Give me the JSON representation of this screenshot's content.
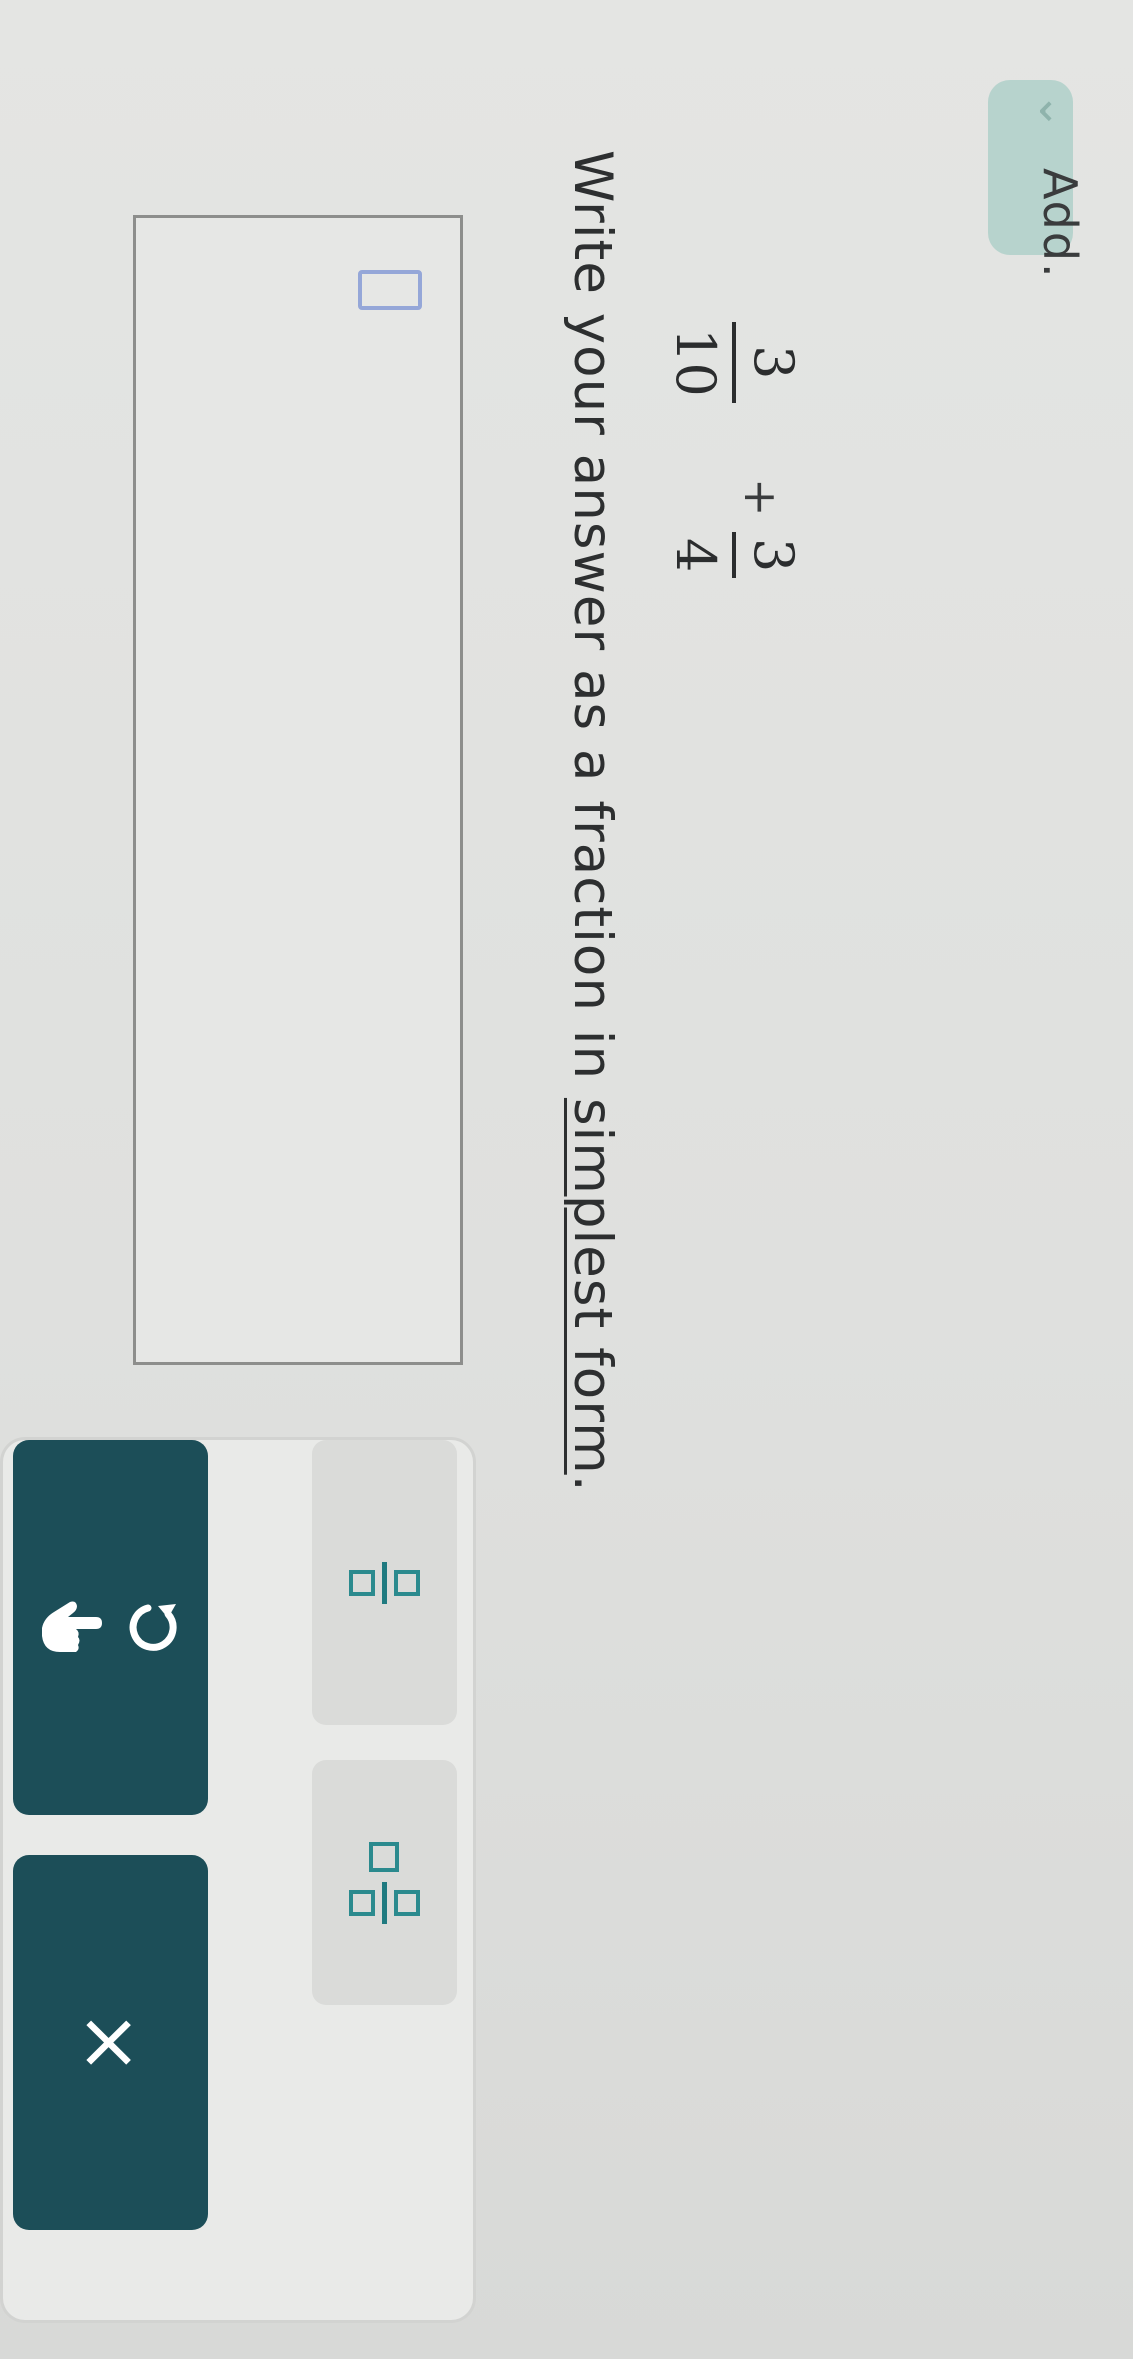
{
  "problem": {
    "prompt": "Add.",
    "expression": {
      "first": {
        "numerator": "3",
        "denominator": "10"
      },
      "operator": "+",
      "second": {
        "numerator": "3",
        "denominator": "4"
      }
    },
    "instruction_before": "Write your answer as a fraction in ",
    "instruction_link": "simplest form",
    "instruction_after": "."
  },
  "answer": {
    "value": "",
    "placeholder": ""
  },
  "tools": {
    "fraction_tool_icon": "fraction-template-icon",
    "mixed_number_tool_icon": "mixed-number-template-icon",
    "undo_icon": "undo-arrow-icon",
    "cursor_icon": "pointing-hand-icon",
    "clear_label": "×"
  },
  "colors": {
    "accent_teal": "#2b8a8e",
    "button_dark": "#1c4e58",
    "tab_mint": "#b7d3cd"
  }
}
